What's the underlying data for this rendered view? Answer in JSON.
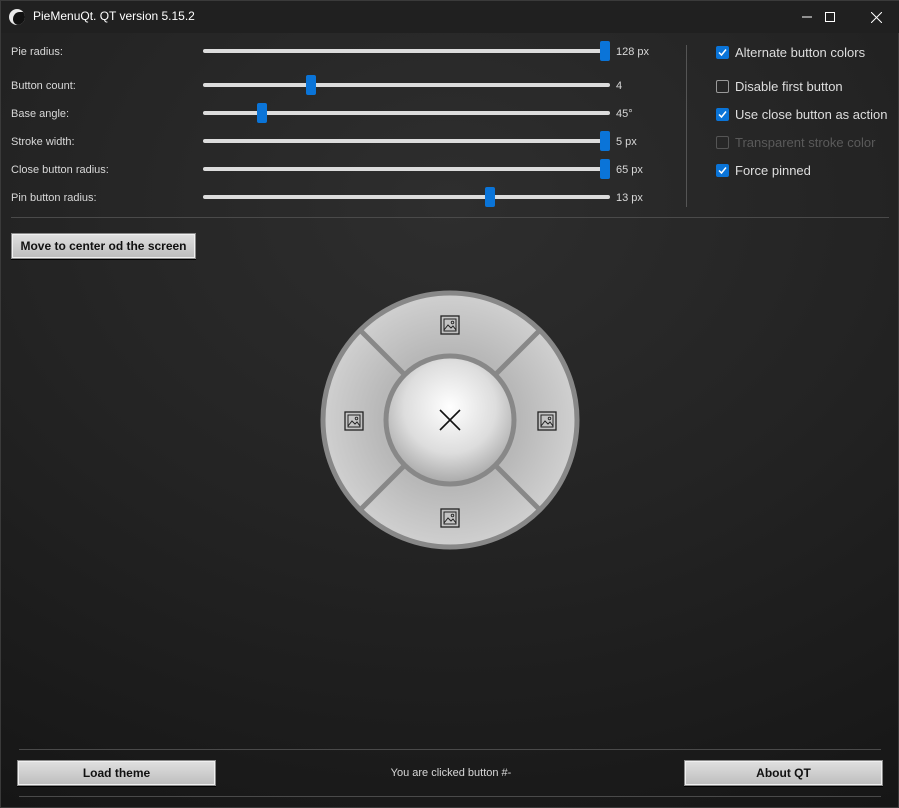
{
  "window": {
    "title": "PieMenuQt. QT version 5.15.2"
  },
  "sliders": [
    {
      "label": "Pie radius:",
      "value_text": "128 px",
      "level": 1.0
    },
    {
      "label": "Button count:",
      "value_text": "4",
      "level": 0.26
    },
    {
      "label": "Base angle:",
      "value_text": "45°",
      "level": 0.135
    },
    {
      "label": "Stroke width:",
      "value_text": "5 px",
      "level": 1.0
    },
    {
      "label": "Close button radius:",
      "value_text": "65 px",
      "level": 1.0
    },
    {
      "label": "Pin button radius:",
      "value_text": "13 px",
      "level": 0.71
    }
  ],
  "checkboxes": [
    {
      "label": "Alternate button colors",
      "checked": true,
      "enabled": true
    },
    {
      "label": "Disable first button",
      "checked": false,
      "enabled": true
    },
    {
      "label": "Use close button as action",
      "checked": true,
      "enabled": true
    },
    {
      "label": "Transparent stroke color",
      "checked": false,
      "enabled": false
    },
    {
      "label": "Force pinned",
      "checked": true,
      "enabled": true
    }
  ],
  "buttons": {
    "center": "Move to center od the screen",
    "load_theme": "Load theme",
    "about": "About QT"
  },
  "status_text": "You are clicked button #-",
  "pie": {
    "segments": [
      "image-icon",
      "image-icon",
      "image-icon",
      "image-icon"
    ],
    "center_icon": "close-icon"
  },
  "colors": {
    "accent": "#0a74d8",
    "pie_fill": "#c8c8c8",
    "pie_stroke": "#8c8c8c"
  }
}
